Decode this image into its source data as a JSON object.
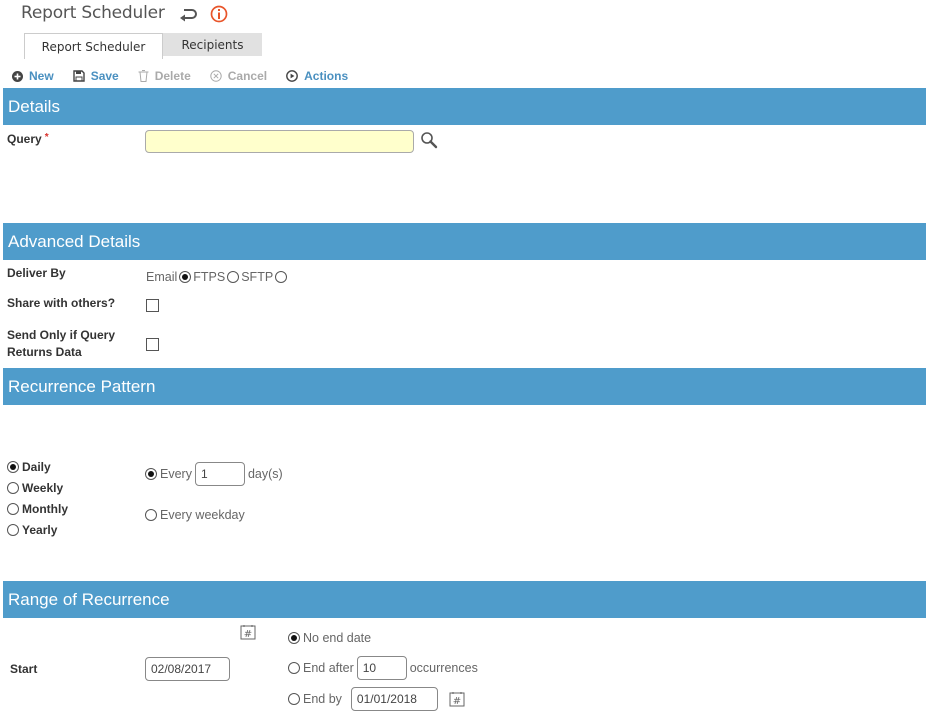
{
  "header": {
    "title": "Report Scheduler",
    "icons": [
      "undo-icon",
      "info-icon"
    ]
  },
  "tabs": [
    {
      "label": "Report Scheduler",
      "active": true
    },
    {
      "label": "Recipients",
      "active": false
    }
  ],
  "toolbar": {
    "new_label": "New",
    "save_label": "Save",
    "delete_label": "Delete",
    "cancel_label": "Cancel",
    "actions_label": "Actions"
  },
  "details": {
    "heading": "Details",
    "query_label": "Query",
    "query_required_mark": "*",
    "query_value": ""
  },
  "advanced": {
    "heading": "Advanced Details",
    "deliver_by_label": "Deliver By",
    "deliver_options": [
      {
        "label": "Email",
        "selected": true
      },
      {
        "label": "FTPS",
        "selected": false
      },
      {
        "label": "SFTP",
        "selected": false
      }
    ],
    "share_label": "Share with others?",
    "share_checked": false,
    "send_only_label_line1": "Send Only if Query",
    "send_only_label_line2": "Returns Data",
    "send_only_checked": false
  },
  "recurrence": {
    "heading": "Recurrence Pattern",
    "patterns": [
      {
        "label": "Daily",
        "selected": true
      },
      {
        "label": "Weekly",
        "selected": false
      },
      {
        "label": "Monthly",
        "selected": false
      },
      {
        "label": "Yearly",
        "selected": false
      }
    ],
    "every_label": "Every",
    "every_value": "1",
    "days_suffix": "day(s)",
    "every_selected": true,
    "weekday_label": "Every weekday",
    "weekday_selected": false
  },
  "range": {
    "heading": "Range of Recurrence",
    "start_label": "Start",
    "start_value": "02/08/2017",
    "no_end_label": "No end date",
    "no_end_selected": true,
    "end_after_label": "End after",
    "end_after_value": "10",
    "occurrences_suffix": "occurrences",
    "end_after_selected": false,
    "end_by_label": "End by",
    "end_by_value": "01/01/2018",
    "end_by_selected": false
  }
}
